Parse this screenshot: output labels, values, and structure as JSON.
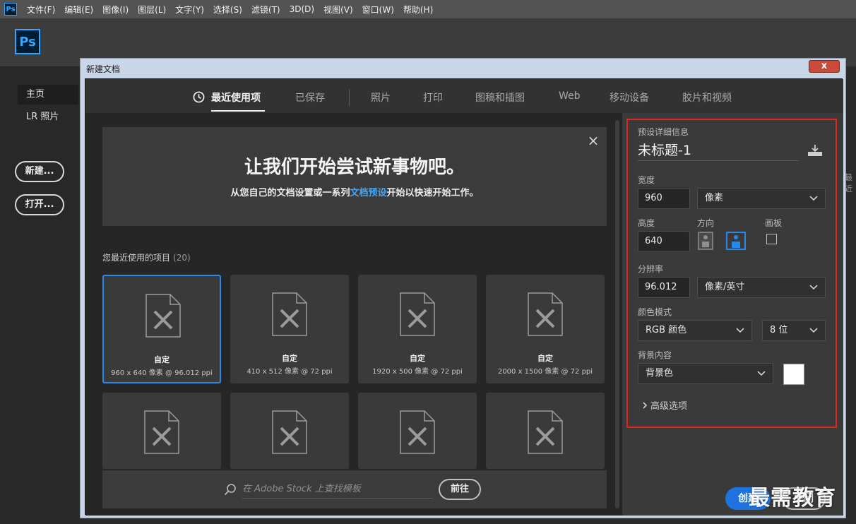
{
  "menubar": {
    "app_icon": "Ps",
    "items": [
      "文件(F)",
      "编辑(E)",
      "图像(I)",
      "图层(L)",
      "文字(Y)",
      "选择(S)",
      "滤镜(T)",
      "3D(D)",
      "视图(V)",
      "窗口(W)",
      "帮助(H)"
    ]
  },
  "app": {
    "logo": "Ps",
    "left_nav": [
      "主页",
      "LR 照片"
    ],
    "new_button": "新建...",
    "open_button": "打开..."
  },
  "dialog": {
    "title": "新建文档",
    "close_glyph": "x"
  },
  "tabs": [
    "最近使用项",
    "已保存",
    "照片",
    "打印",
    "图稿和插图",
    "Web",
    "移动设备",
    "胶片和视频"
  ],
  "welcome": {
    "close_glyph": "×",
    "title": "让我们开始尝试新事物吧。",
    "sub_before": "从您自己的文档设置或一系列",
    "sub_link": "文档预设",
    "sub_after": "开始以快速开始工作。"
  },
  "recent": {
    "label": "您最近使用的项目",
    "count": "(20)",
    "cards": [
      {
        "name": "自定",
        "desc": "960 x 640 像素 @ 96.012 ppi"
      },
      {
        "name": "自定",
        "desc": "410 x 512 像素 @ 72 ppi"
      },
      {
        "name": "自定",
        "desc": "1920 x 500 像素 @ 72 ppi"
      },
      {
        "name": "自定",
        "desc": "2000 x 1500 像素 @ 72 ppi"
      }
    ]
  },
  "stock": {
    "placeholder": "在 Adobe Stock 上查找模板",
    "go_button": "前往"
  },
  "preset": {
    "section_label": "预设详细信息",
    "doc_name": "未标题-1",
    "width_label": "宽度",
    "width_value": "960",
    "width_unit": "像素",
    "height_label": "高度",
    "height_value": "640",
    "orientation_label": "方向",
    "artboard_label": "画板",
    "resolution_label": "分辨率",
    "resolution_value": "96.012",
    "resolution_unit": "像素/英寸",
    "color_mode_label": "颜色模式",
    "color_mode": "RGB 颜色",
    "bit_depth": "8 位",
    "bg_label": "背景内容",
    "bg_value": "背景色",
    "advanced": "高级选项",
    "bg_swatch_color": "#ffffff"
  },
  "buttons": {
    "create": "创建",
    "close": "关闭"
  },
  "watermark": "最需教育",
  "colors": {
    "accent": "#1f73e0",
    "highlight_box": "#e0251b",
    "link": "#4aa3f0"
  }
}
